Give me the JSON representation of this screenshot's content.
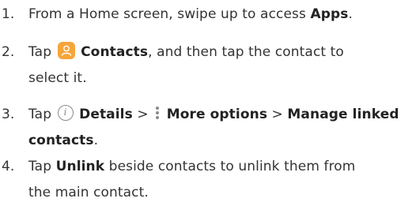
{
  "steps": [
    {
      "number": "1.",
      "pre": "From a Home screen, swipe up to access ",
      "bold": "Apps",
      "post": "."
    },
    {
      "number": "2.",
      "pre": "Tap ",
      "icon": "contacts-app-icon",
      "bold": "Contacts",
      "post": ", and then tap the contact to",
      "line2": "select it."
    },
    {
      "number": "3.",
      "pre": "Tap ",
      "icon1": "info-details-icon",
      "bold1": "Details",
      "sep1": " > ",
      "icon2": "more-options-icon",
      "bold2": "More options",
      "sep2": " > ",
      "bold3": "Manage linked",
      "line2_bold": "contacts",
      "line2_post": "."
    },
    {
      "number": "4.",
      "pre": "Tap ",
      "bold": "Unlink",
      "post": " beside contacts to unlink them from",
      "line2": "the main contact."
    }
  ],
  "colors": {
    "text": "#333333",
    "contacts_icon_bg": "#f6a53a",
    "icon_gray": "#8a8a8a"
  }
}
